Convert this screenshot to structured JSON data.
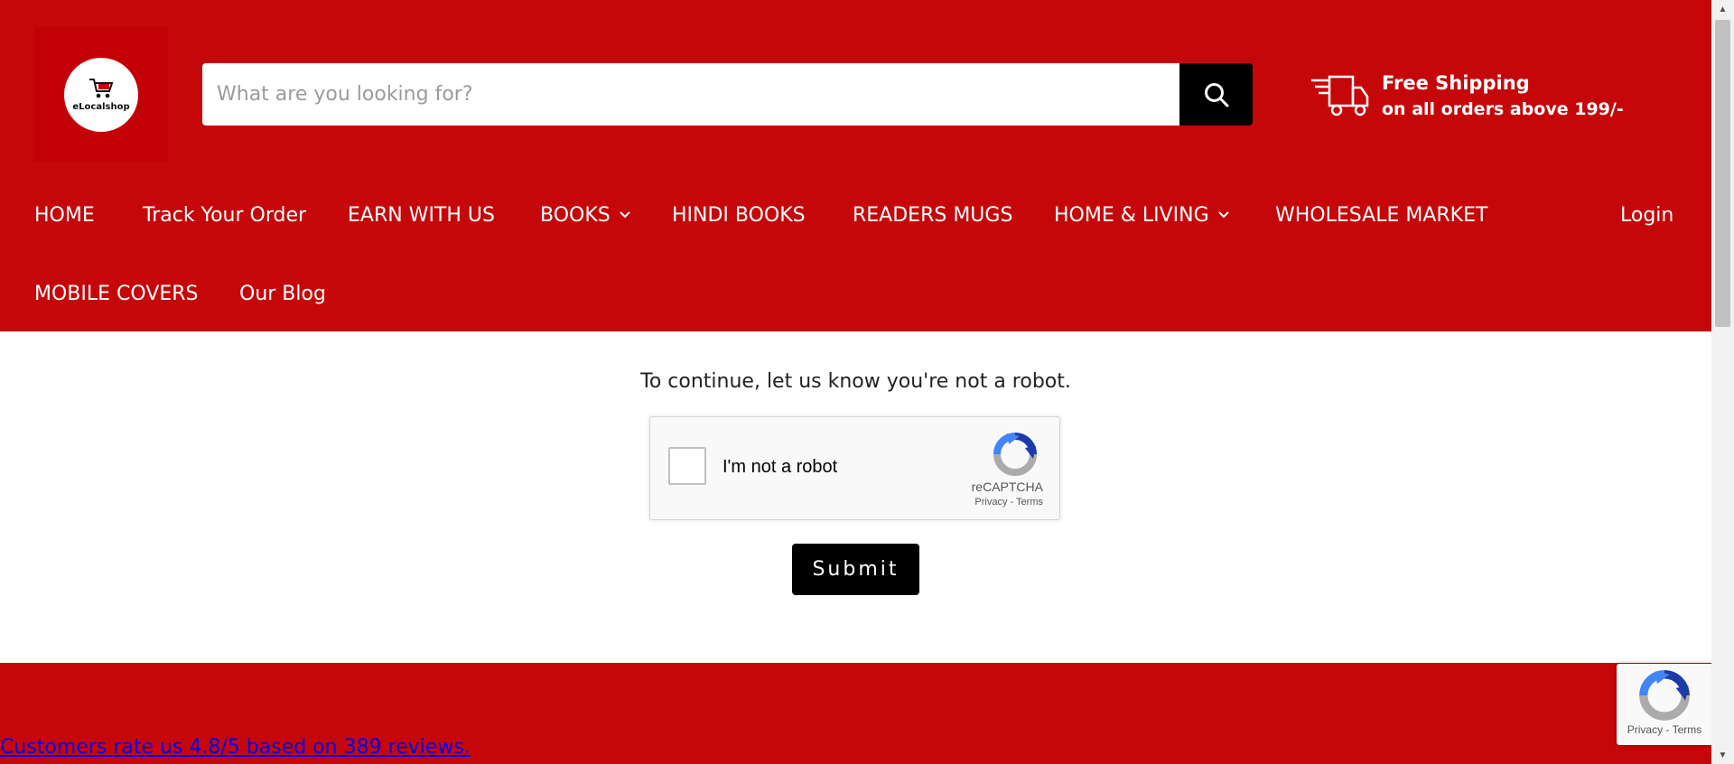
{
  "header": {
    "logo_text": "eLocalshop",
    "search": {
      "placeholder": "What are you looking for?"
    },
    "shipping": {
      "title": "Free Shipping",
      "subtitle": "on all orders above 199/-"
    }
  },
  "nav": {
    "items": [
      {
        "label": "HOME"
      },
      {
        "label": "Track Your Order"
      },
      {
        "label": "EARN WITH US"
      },
      {
        "label": "BOOKS"
      },
      {
        "label": "HINDI BOOKS"
      },
      {
        "label": "READERS MUGS"
      },
      {
        "label": "HOME & LIVING"
      },
      {
        "label": "WHOLESALE MARKET"
      },
      {
        "label": "MOBILE COVERS"
      },
      {
        "label": "Our Blog"
      }
    ],
    "login": "Login"
  },
  "main": {
    "robot_message": "To continue, let us know you're not a robot.",
    "captcha": {
      "label": "I'm not a robot",
      "brand": "reCAPTCHA",
      "privacy": "Privacy",
      "separator": " - ",
      "terms": "Terms"
    },
    "submit_label": "Submit"
  },
  "footer": {
    "reviews_link": "Customers rate us 4.8/5 based on 389 reviews.",
    "badge_privacy": "Privacy",
    "badge_separator": " - ",
    "badge_terms": "Terms"
  },
  "colors": {
    "header_red": "#c5070a",
    "logo_box": "#c30005",
    "button_black": "#000000",
    "link_blue": "#0000ee"
  },
  "icons": [
    "cart-icon",
    "search-icon",
    "truck-icon",
    "chevron-down-icon",
    "recaptcha-icon"
  ]
}
